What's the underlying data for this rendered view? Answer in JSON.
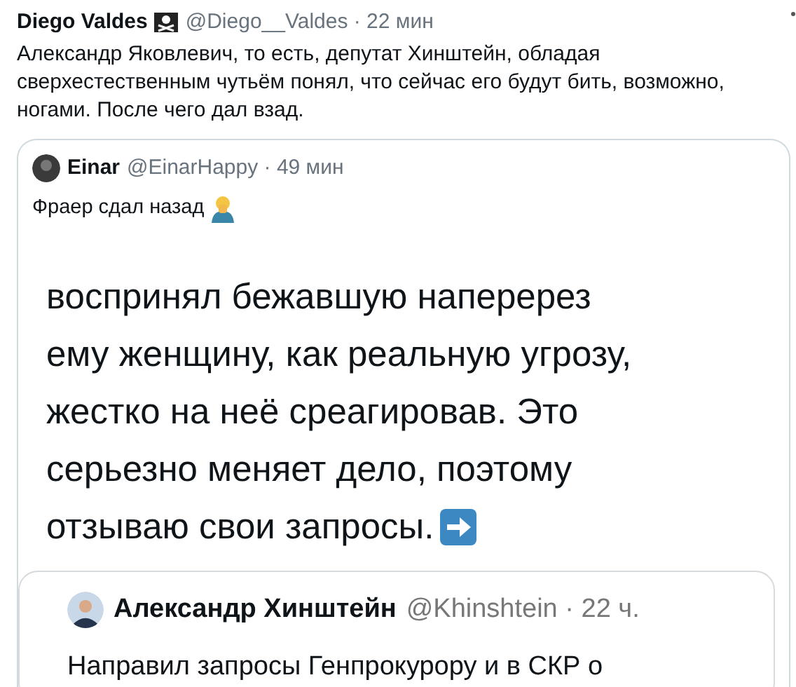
{
  "tweet": {
    "author": "Diego Valdes",
    "meta": "@Diego__Valdes · 22 мин",
    "text": "Александр Яковлевич, то есть, депутат Хинштейн, обладая сверхестественным чутьём понял, что сейчас его будут бить, возможно, ногами. После чего дал взад."
  },
  "quote": {
    "author": "Einar",
    "meta": "@EinarHappy · 49 мин",
    "text": "Фраер сдал назад",
    "screenshot": {
      "lines": [
        "воспринял бежавшую наперерез",
        "ему женщину, как реальную угрозу,",
        "жестко на неё среагировав. Это",
        "серьезно меняет дело, поэтому",
        "отзываю свои запросы."
      ],
      "inner_quote": {
        "author": "Александр Хинштейн",
        "meta": "@Khinshtein · 22 ч.",
        "text": "Направил запросы Генпрокурору и в СКР о"
      }
    }
  }
}
